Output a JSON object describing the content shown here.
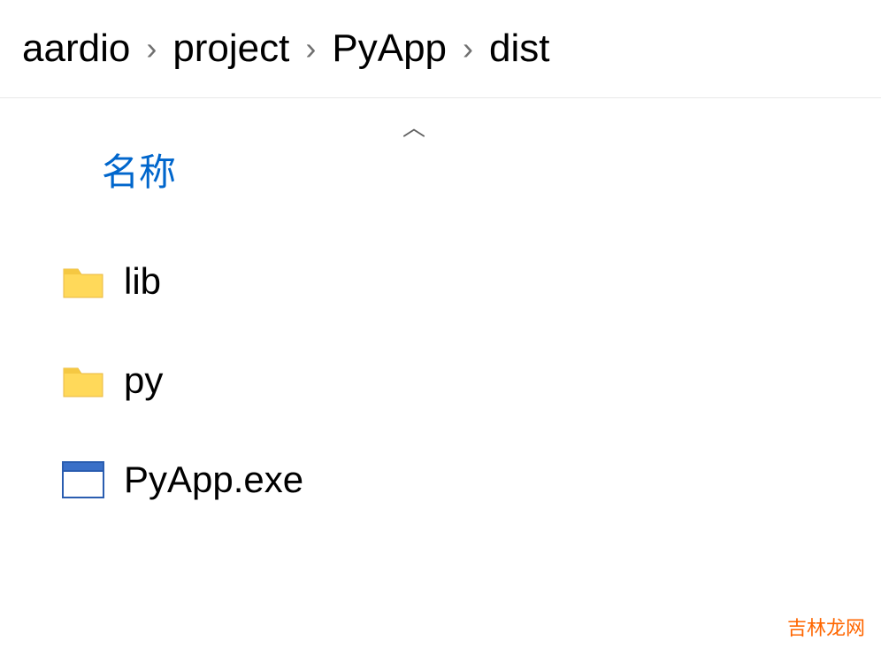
{
  "breadcrumb": {
    "segments": [
      "aardio",
      "project",
      "PyApp",
      "dist"
    ]
  },
  "columns": {
    "name_header": "名称"
  },
  "items": [
    {
      "name": "lib",
      "type": "folder"
    },
    {
      "name": "py",
      "type": "folder"
    },
    {
      "name": "PyApp.exe",
      "type": "exe"
    }
  ],
  "watermark": "吉林龙网"
}
